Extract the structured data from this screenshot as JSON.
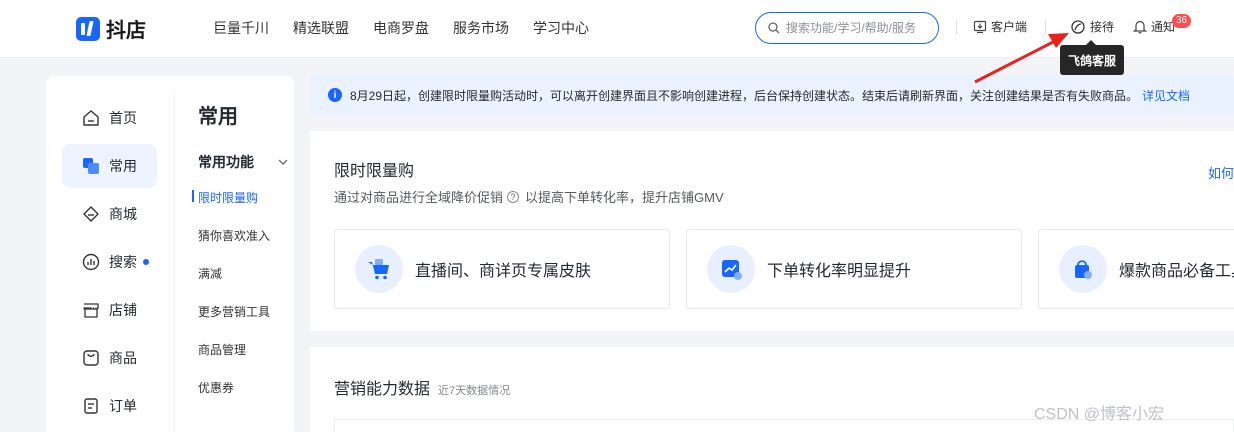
{
  "brand": {
    "name": "抖店",
    "color": "#1966ff"
  },
  "top_nav": [
    "巨量千川",
    "精选联盟",
    "电商罗盘",
    "服务市场",
    "学习中心"
  ],
  "search": {
    "placeholder": "搜索功能/学习/帮助/服务"
  },
  "toolbar": {
    "client": "客户端",
    "reception": "接待",
    "notify": "通知",
    "notify_count": "36",
    "tooltip": "飞鸽客服"
  },
  "sidebar": {
    "nav": [
      {
        "label": "首页",
        "icon": "home-icon"
      },
      {
        "label": "常用",
        "icon": "favorites-icon",
        "active": true
      },
      {
        "label": "商城",
        "icon": "mall-icon"
      },
      {
        "label": "搜索",
        "icon": "search-chart-icon",
        "dot": true
      },
      {
        "label": "店铺",
        "icon": "shop-icon"
      },
      {
        "label": "商品",
        "icon": "product-icon"
      },
      {
        "label": "订单",
        "icon": "order-icon"
      }
    ],
    "sub_title": "常用",
    "group_title": "常用功能",
    "sub_items": [
      "限时限量购",
      "猜你喜欢准入",
      "满减",
      "更多营销工具",
      "商品管理",
      "优惠券"
    ]
  },
  "notice": {
    "text": "8月29日起，创建限时限量购活动时，可以离开创建界面且不影响创建进程，后台保持创建状态。结束后请刷新界面，关注创建结果是否有失败商品。",
    "link": "详见文档"
  },
  "main_card": {
    "title": "限时限量购",
    "desc_before": "通过对商品进行全域降价促销",
    "desc_after": "以提高下单转化率，提升店铺GMV",
    "more_link": "如何",
    "features": [
      "直播间、商详页专属皮肤",
      "下单转化率明显提升",
      "爆款商品必备工具"
    ]
  },
  "data_card": {
    "title": "营销能力数据",
    "subtitle": "近7天数据情况"
  },
  "watermark": "CSDN @博客小宏"
}
